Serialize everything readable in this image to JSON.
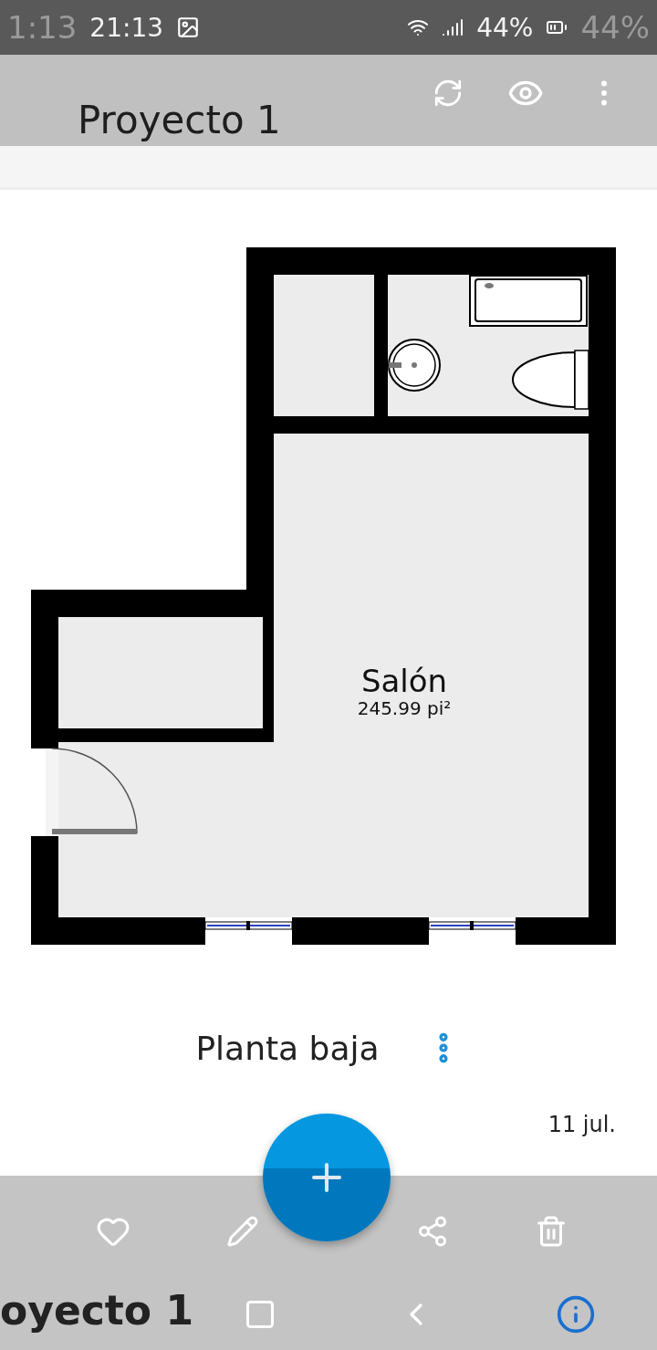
{
  "status_bar": {
    "time": "21:13",
    "battery": "44%",
    "overlay_time": "1:13",
    "overlay_battery": "44%"
  },
  "toolbar": {
    "title": "Proyecto 1"
  },
  "plan": {
    "rooms": [
      {
        "name": "Salón",
        "area": "245.99 pi²"
      }
    ]
  },
  "floor": {
    "name": "Planta baja",
    "date": "11 jul."
  },
  "action_bar": {
    "overlay_title": "oyecto 1"
  }
}
